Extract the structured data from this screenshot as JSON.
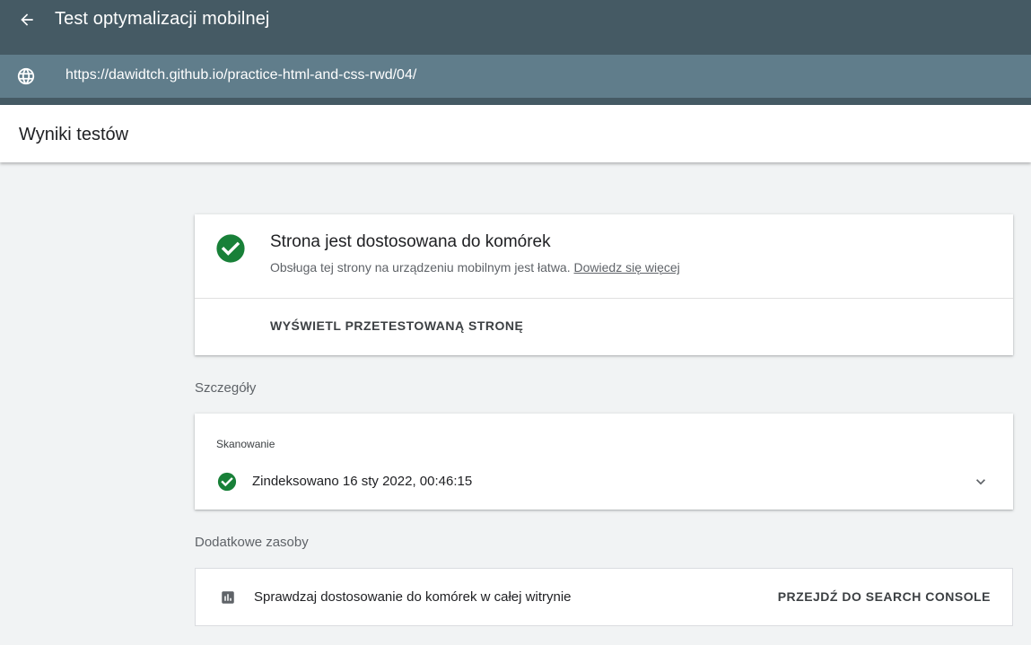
{
  "header": {
    "title": "Test optymalizacji mobilnej",
    "url": "https://dawidtch.github.io/practice-html-and-css-rwd/04/",
    "back_icon": "arrow-back-icon",
    "globe_icon": "globe-icon",
    "background_color": "#455a64",
    "urlbar_color": "#607d8b"
  },
  "subheader": {
    "title": "Wyniki testów"
  },
  "result": {
    "title": "Strona jest dostosowana do komórek",
    "description": "Obsługa tej strony na urządzeniu mobilnym jest łatwa.",
    "learn_more": "Dowiedz się więcej",
    "view_button": "WYŚWIETL PRZETESTOWANĄ STRONĘ",
    "status_icon": "check-circle-icon",
    "status_color": "#188038"
  },
  "details": {
    "section_label": "Szczegóły",
    "scan_label": "Skanowanie",
    "indexed_text": "Zindeksowano 16 sty 2022, 00:46:15",
    "expand_icon": "chevron-down-icon"
  },
  "extra": {
    "section_label": "Dodatkowe zasoby",
    "text": "Sprawdzaj dostosowanie do komórek w całej witrynie",
    "button": "PRZEJDŹ DO SEARCH CONSOLE",
    "icon": "bar-chart-icon"
  }
}
